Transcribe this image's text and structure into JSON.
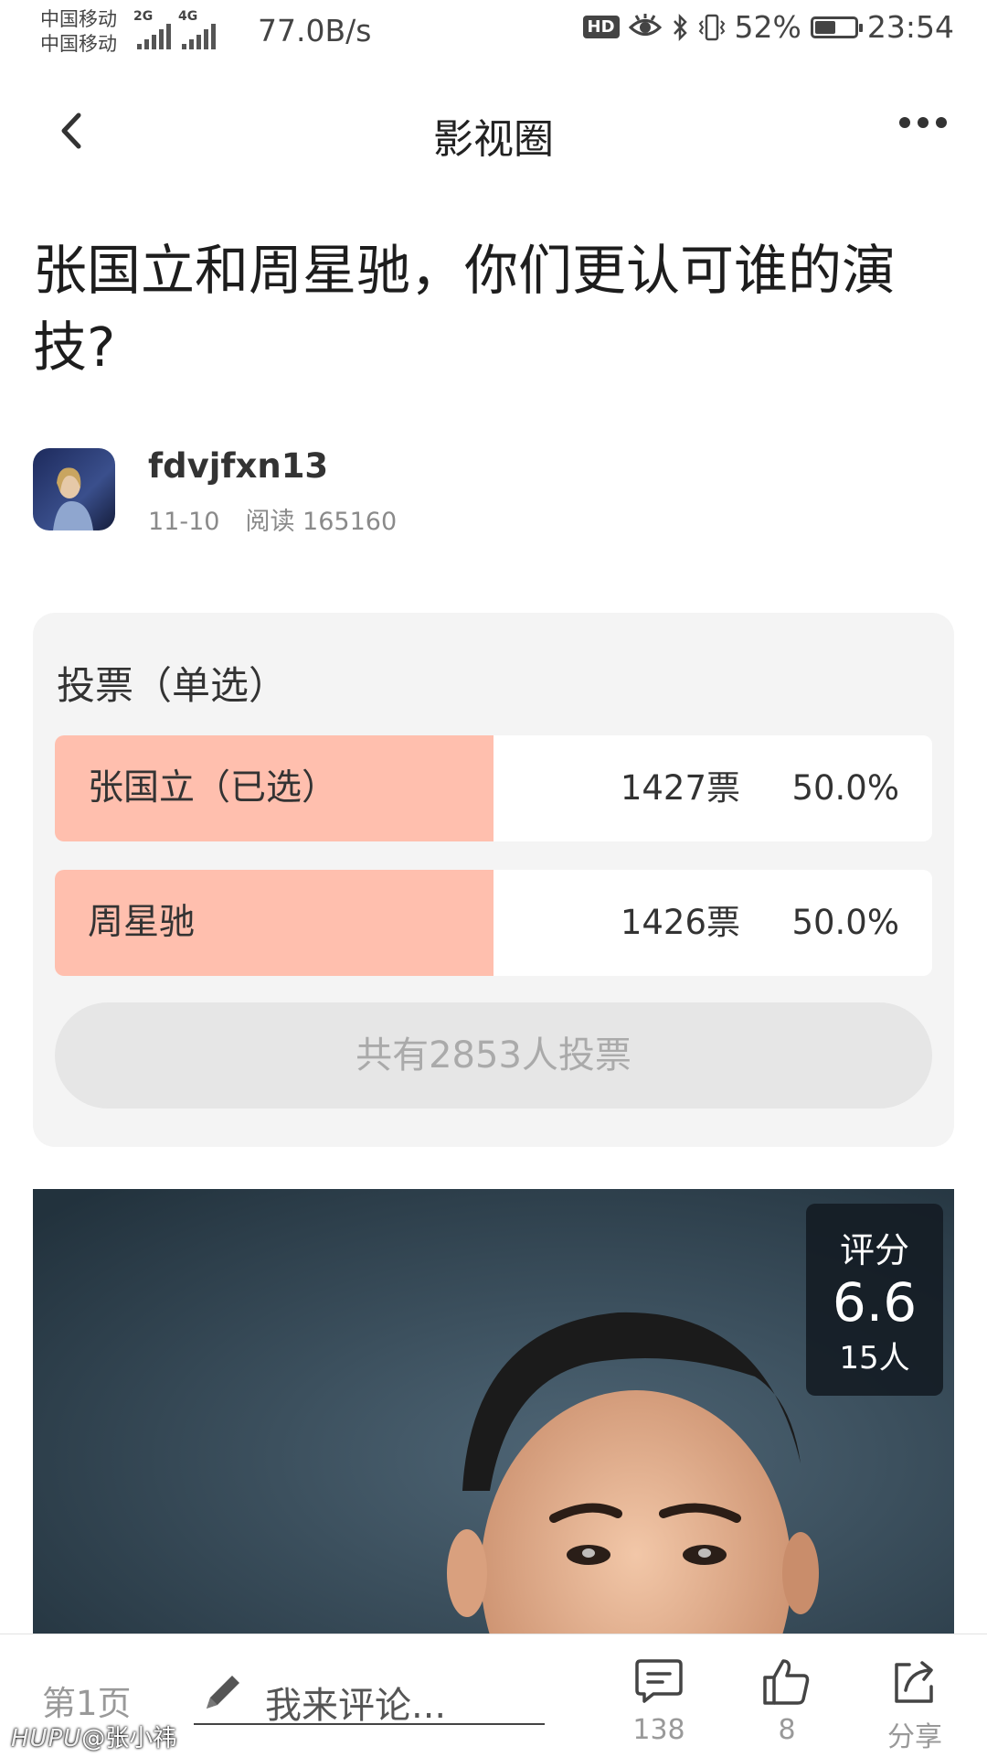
{
  "status_bar": {
    "carrier1": "中国移动",
    "carrier2": "中国移动",
    "net1": "2G",
    "net2": "4G",
    "speed": "77.0B/s",
    "hd": "HD",
    "battery_pct": "52%",
    "battery_level": 0.52,
    "time": "23:54"
  },
  "nav": {
    "title": "影视圈"
  },
  "post": {
    "title": "张国立和周星驰，你们更认可谁的演技?",
    "author": "fdvjfxn13",
    "date": "11-10",
    "reads": "阅读 165160"
  },
  "vote": {
    "title": "投票（单选）",
    "options": [
      {
        "label": "张国立（已选）",
        "votes": "1427票",
        "percent": "50.0%",
        "share": 0.5
      },
      {
        "label": "周星驰",
        "votes": "1426票",
        "percent": "50.0%",
        "share": 0.5
      }
    ],
    "total": "共有2853人投票"
  },
  "rating": {
    "label": "评分",
    "value": "6.6",
    "count": "15人"
  },
  "bottom": {
    "page": "第1页",
    "comment_placeholder": "我来评论...",
    "comments": "138",
    "likes": "8",
    "share": "分享"
  },
  "watermark": {
    "brand": "HUPU",
    "user": "@张小祎"
  },
  "colors": {
    "vote_bar": "#ffbfae",
    "total_bg": "#e6e6e6",
    "card_bg": "#f4f4f4"
  }
}
